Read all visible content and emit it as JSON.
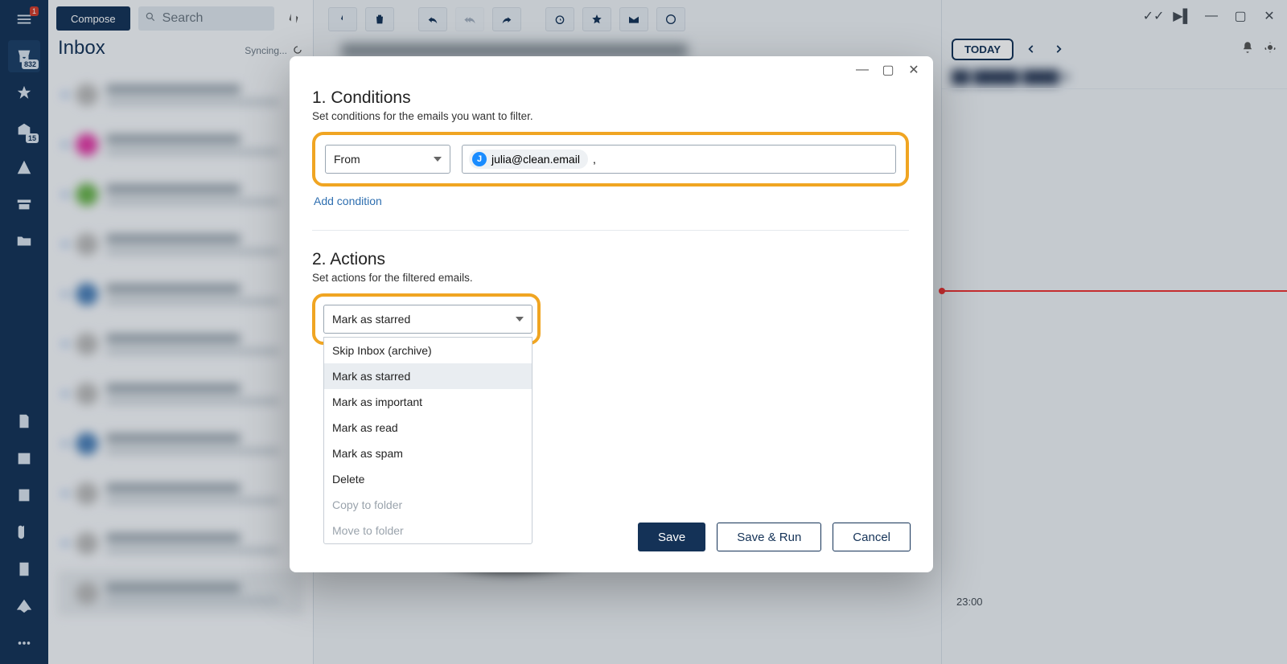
{
  "sidebar": {
    "menu_badge": "1",
    "inbox_badge": "832",
    "starred_badge": "15"
  },
  "leftpane": {
    "compose": "Compose",
    "search_placeholder": "Search",
    "title": "Inbox",
    "sync_status": "Syncing..."
  },
  "calendar": {
    "today": "TODAY",
    "time_label": "23:00"
  },
  "dialog": {
    "conditions": {
      "title": "1. Conditions",
      "subtitle": "Set conditions for the emails you want to filter.",
      "field_label": "From",
      "chip_initial": "J",
      "chip_email": "julia@clean.email",
      "trailing": ",",
      "add": "Add condition"
    },
    "actions": {
      "title": "2. Actions",
      "subtitle": "Set actions for the filtered emails.",
      "selected": "Mark as starred",
      "options": [
        "Skip Inbox (archive)",
        "Mark as starred",
        "Mark as important",
        "Mark as read",
        "Mark as spam",
        "Delete",
        "Copy to folder",
        "Move to folder"
      ]
    },
    "footer": {
      "save": "Save",
      "save_run": "Save & Run",
      "cancel": "Cancel"
    }
  }
}
